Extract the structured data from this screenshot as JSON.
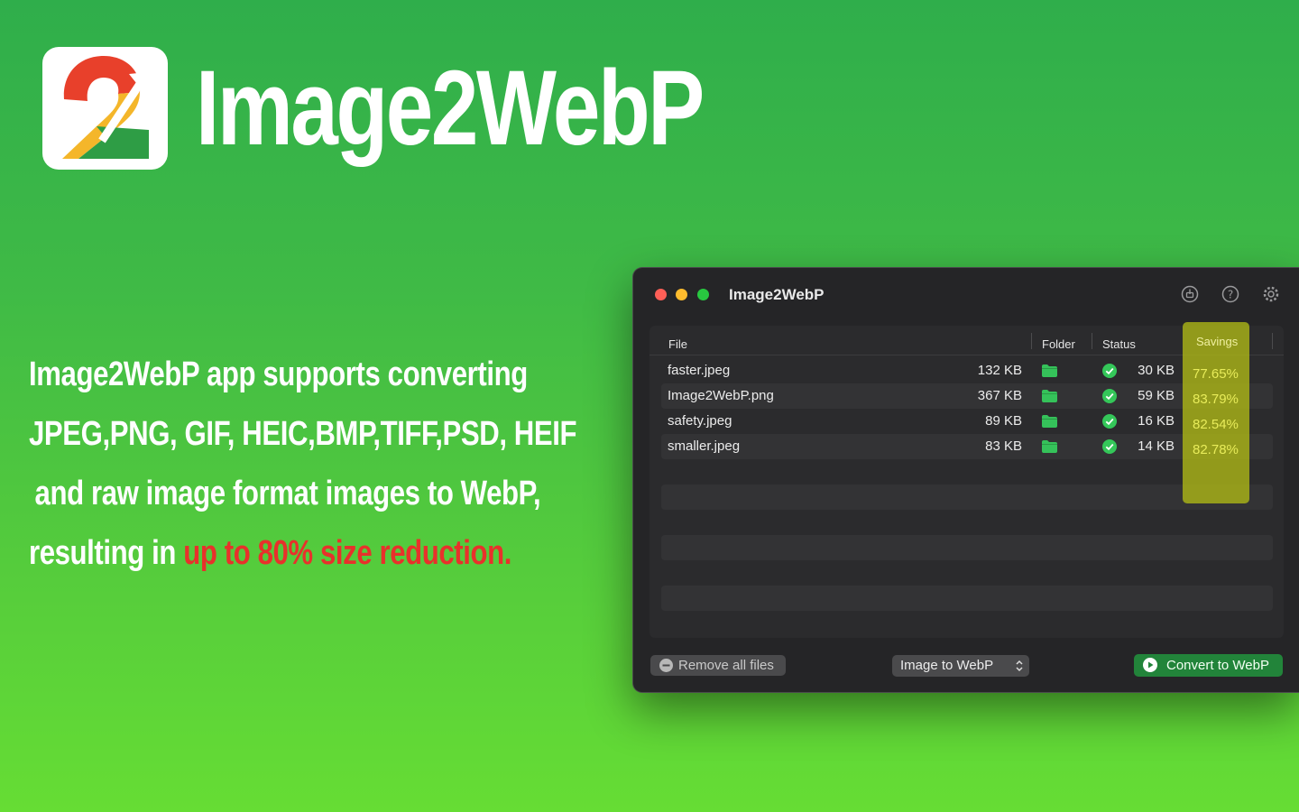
{
  "hero": {
    "title": "Image2WebP"
  },
  "pitch": {
    "line1": "Image2WebP app supports converting",
    "line2": "JPEG,PNG, GIF, HEIC,BMP,TIFF,PSD, HEIF",
    "line3": "and raw image format images to WebP,",
    "line4_prefix": "resulting in ",
    "line4_highlight": "up to 80% size reduction."
  },
  "window": {
    "title": "Image2WebP",
    "toolbar_icons": [
      "share-icon",
      "help-icon",
      "gear-icon"
    ]
  },
  "table": {
    "headers": {
      "file": "File",
      "folder": "Folder",
      "status": "Status",
      "savings": "Savings"
    },
    "rows": [
      {
        "name": "faster.jpeg",
        "size": "132 KB",
        "output": "30 KB",
        "savings": "77.65%"
      },
      {
        "name": "Image2WebP.png",
        "size": "367 KB",
        "output": "59 KB",
        "savings": "83.79%"
      },
      {
        "name": "safety.jpeg",
        "size": "89 KB",
        "output": "16 KB",
        "savings": "82.54%"
      },
      {
        "name": "smaller.jpeg",
        "size": "83 KB",
        "output": "14 KB",
        "savings": "82.78%"
      }
    ]
  },
  "footer": {
    "remove_label": "Remove all files",
    "mode_label": "Image to WebP",
    "convert_label": "Convert to WebP"
  },
  "colors": {
    "accent_green": "#22843a",
    "savings_highlight": "#b0ba16",
    "reduction_red": "#e8312b"
  }
}
